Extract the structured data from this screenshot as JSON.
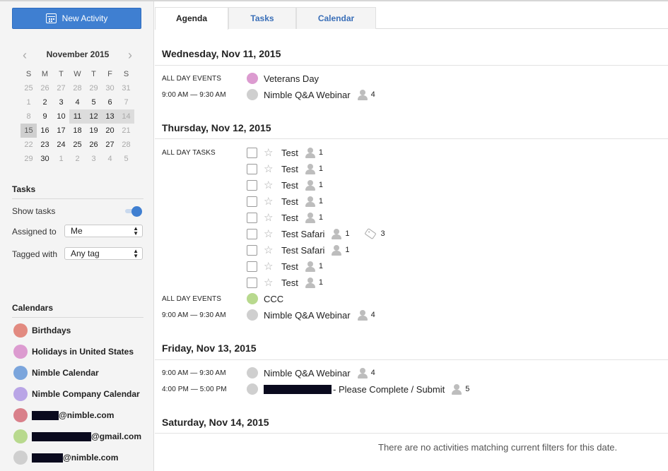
{
  "sidebar": {
    "new_activity_label": "New Activity",
    "mini_calendar": {
      "month_title": "November 2015",
      "weekday_headers": [
        "S",
        "M",
        "T",
        "W",
        "T",
        "F",
        "S"
      ],
      "weeks": [
        [
          "25",
          "26",
          "27",
          "28",
          "29",
          "30",
          "31"
        ],
        [
          "1",
          "2",
          "3",
          "4",
          "5",
          "6",
          "7"
        ],
        [
          "8",
          "9",
          "10",
          "11",
          "12",
          "13",
          "14"
        ],
        [
          "15",
          "16",
          "17",
          "18",
          "19",
          "20",
          "21"
        ],
        [
          "22",
          "23",
          "24",
          "25",
          "26",
          "27",
          "28"
        ],
        [
          "29",
          "30",
          "1",
          "2",
          "3",
          "4",
          "5"
        ]
      ]
    },
    "tasks": {
      "title": "Tasks",
      "show_tasks_label": "Show tasks",
      "assigned_to_label": "Assigned to",
      "assigned_to_value": "Me",
      "tagged_with_label": "Tagged with",
      "tagged_with_value": "Any tag"
    },
    "calendars": {
      "title": "Calendars",
      "items": [
        {
          "label": "Birthdays",
          "color": "#e28a80"
        },
        {
          "label": "Holidays in United States",
          "color": "#dc9bd0"
        },
        {
          "label": "Nimble Calendar",
          "color": "#7ba5dc"
        },
        {
          "label": "Nimble Company Calendar",
          "color": "#b9a5e6"
        },
        {
          "label": "@nimble.com",
          "color": "#d9808a"
        },
        {
          "label": "@gmail.com",
          "color": "#b8d98e"
        },
        {
          "label": "@nimble.com",
          "color": "#cfcfcf"
        }
      ]
    }
  },
  "tabs": [
    {
      "label": "Agenda"
    },
    {
      "label": "Tasks"
    },
    {
      "label": "Calendar"
    }
  ],
  "agenda": {
    "days": [
      {
        "header": "Wednesday, Nov 11, 2015",
        "all_day_events_label": "ALL DAY EVENTS",
        "all_day_event": "Veterans Day",
        "timed": [
          {
            "time": "9:00 AM — 9:30 AM",
            "title": "Nimble Q&A Webinar",
            "count": "4"
          }
        ]
      },
      {
        "header": "Thursday, Nov 12, 2015",
        "all_day_tasks_label": "ALL DAY TASKS",
        "tasks": [
          {
            "title": "Test",
            "count": "1"
          },
          {
            "title": "Test",
            "count": "1"
          },
          {
            "title": "Test",
            "count": "1"
          },
          {
            "title": "Test",
            "count": "1"
          },
          {
            "title": "Test",
            "count": "1"
          },
          {
            "title": "Test Safari",
            "count": "1",
            "tag_count": "3"
          },
          {
            "title": "Test Safari",
            "count": "1"
          },
          {
            "title": "Test",
            "count": "1"
          },
          {
            "title": "Test",
            "count": "1"
          }
        ],
        "all_day_events_label": "ALL DAY EVENTS",
        "all_day_event": "CCC",
        "timed": [
          {
            "time": "9:00 AM — 9:30 AM",
            "title": "Nimble Q&A Webinar",
            "count": "4"
          }
        ]
      },
      {
        "header": "Friday, Nov 13, 2015",
        "timed": [
          {
            "time": "9:00 AM — 9:30 AM",
            "title": "Nimble Q&A Webinar",
            "count": "4"
          },
          {
            "time": "4:00 PM — 5:00 PM",
            "title": "- Please Complete / Submit",
            "count": "5"
          }
        ]
      },
      {
        "header": "Saturday, Nov 14, 2015",
        "empty_message": "There are no activities matching current filters for this date."
      }
    ]
  },
  "colors": {
    "accent": "#3f7fd1",
    "veterans_day": "#dc9bd0",
    "ccc": "#b8d98e",
    "neutral_event": "#cfcfcf"
  }
}
